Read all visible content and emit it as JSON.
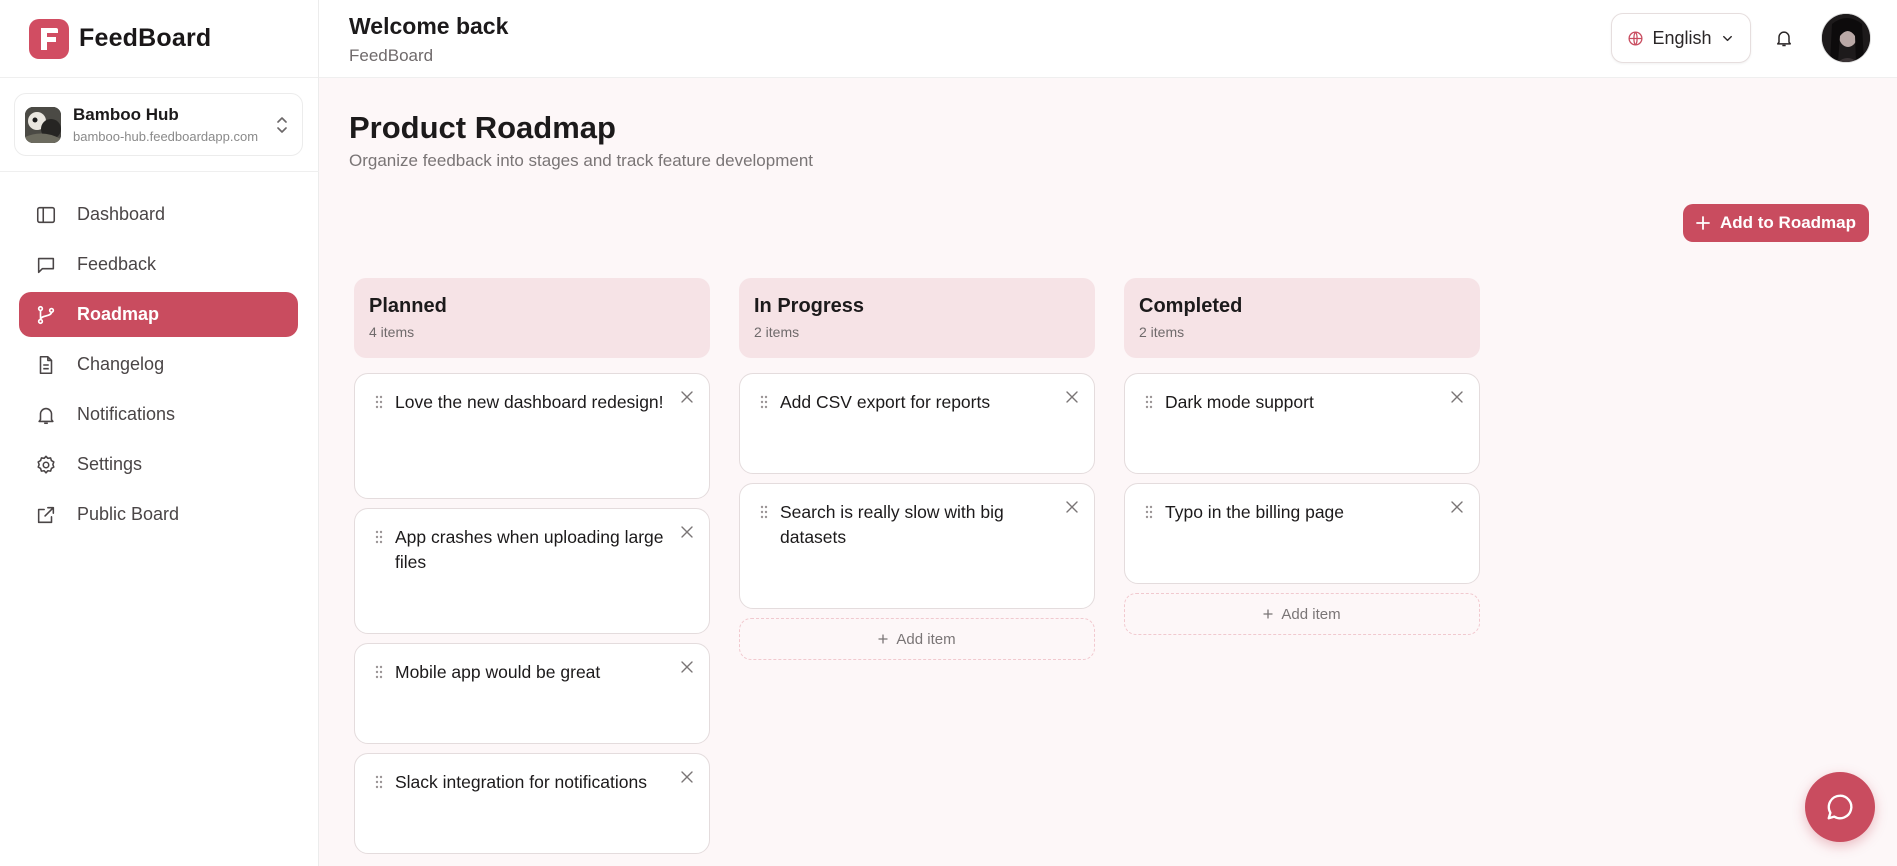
{
  "brand": {
    "name": "FeedBoard",
    "accent": "#c94c5f"
  },
  "workspace": {
    "name": "Bamboo Hub",
    "url": "bamboo-hub.feedboardapp.com"
  },
  "nav": {
    "items": [
      {
        "label": "Dashboard",
        "icon": "panel-icon"
      },
      {
        "label": "Feedback",
        "icon": "message-square-icon"
      },
      {
        "label": "Roadmap",
        "icon": "git-branch-icon",
        "active": true
      },
      {
        "label": "Changelog",
        "icon": "file-text-icon"
      },
      {
        "label": "Notifications",
        "icon": "bell-icon"
      },
      {
        "label": "Settings",
        "icon": "gear-icon"
      },
      {
        "label": "Public Board",
        "icon": "external-link-icon"
      }
    ]
  },
  "header": {
    "title": "Welcome back",
    "subtitle": "FeedBoard",
    "language": "English"
  },
  "main": {
    "title": "Product Roadmap",
    "subtitle": "Organize feedback into stages and track feature development",
    "add_button": "Add to Roadmap",
    "add_item_label": "Add item",
    "columns": [
      {
        "title": "Planned",
        "count": "4 items",
        "cards": [
          "Love the new dashboard redesign!",
          "App crashes when uploading large files",
          "Mobile app would be great",
          "Slack integration for notifications"
        ]
      },
      {
        "title": "In Progress",
        "count": "2 items",
        "cards": [
          "Add CSV export for reports",
          "Search is really slow with big datasets"
        ]
      },
      {
        "title": "Completed",
        "count": "2 items",
        "cards": [
          "Dark mode support",
          "Typo in the billing page"
        ]
      }
    ]
  }
}
